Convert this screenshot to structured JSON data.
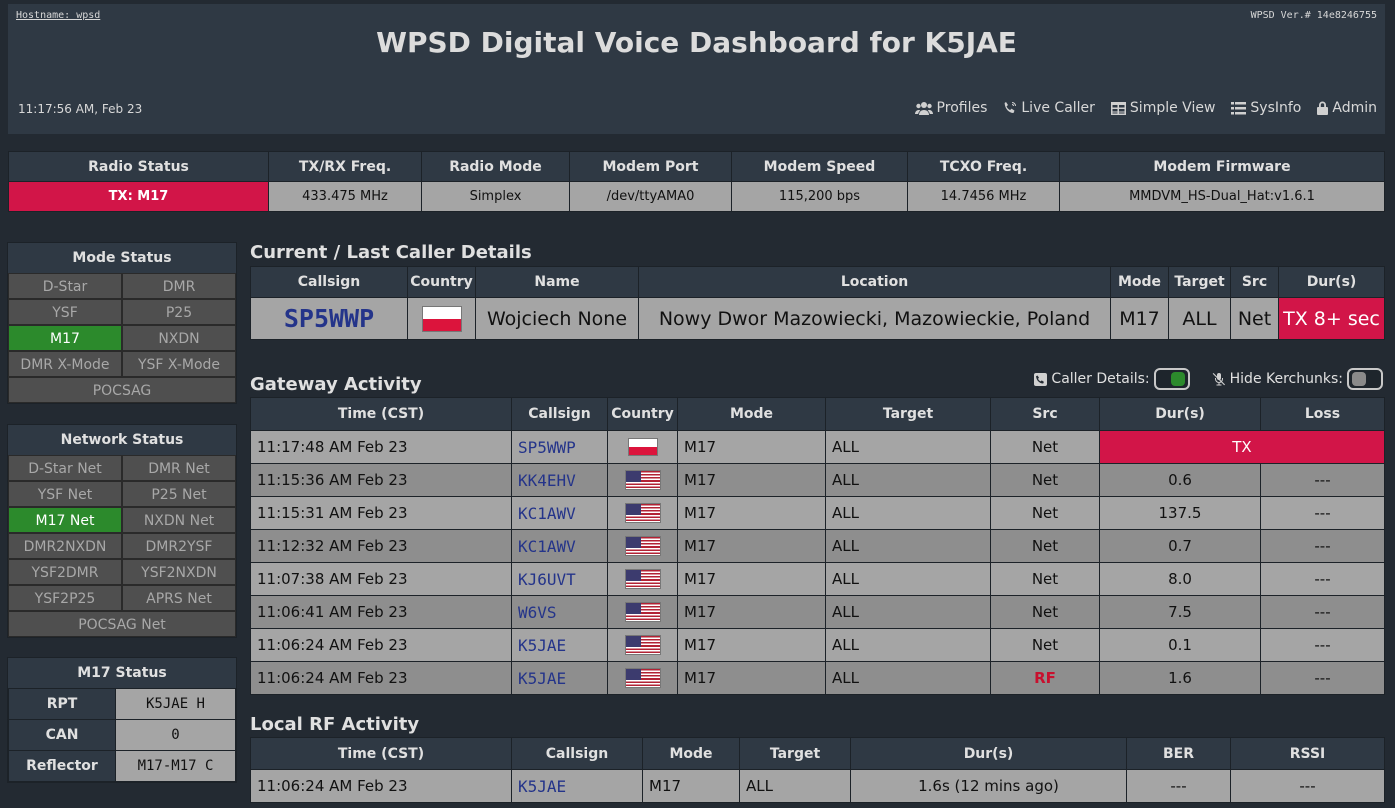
{
  "header": {
    "hostname": "Hostname: wpsd",
    "version": "WPSD Ver.# 14e8246755",
    "title": "WPSD Digital Voice Dashboard for K5JAE",
    "clock": "11:17:56 AM, Feb 23",
    "nav": [
      {
        "label": "Profiles",
        "icon": "users-icon"
      },
      {
        "label": "Live Caller",
        "icon": "phone-wave-icon"
      },
      {
        "label": "Simple View",
        "icon": "table-icon"
      },
      {
        "label": "SysInfo",
        "icon": "list-icon"
      },
      {
        "label": "Admin",
        "icon": "lock-icon"
      }
    ]
  },
  "radio": {
    "headers": [
      "Radio Status",
      "TX/RX Freq.",
      "Radio Mode",
      "Modem Port",
      "Modem Speed",
      "TCXO Freq.",
      "Modem Firmware"
    ],
    "values": [
      "TX: M17",
      "433.475 MHz",
      "Simplex",
      "/dev/ttyAMA0",
      "115,200 bps",
      "14.7456 MHz",
      "MMDVM_HS-Dual_Hat:v1.6.1"
    ]
  },
  "mode_status": {
    "title": "Mode Status",
    "items": [
      {
        "label": "D-Star",
        "active": false
      },
      {
        "label": "DMR",
        "active": false
      },
      {
        "label": "YSF",
        "active": false
      },
      {
        "label": "P25",
        "active": false
      },
      {
        "label": "M17",
        "active": true
      },
      {
        "label": "NXDN",
        "active": false
      },
      {
        "label": "DMR X-Mode",
        "active": false
      },
      {
        "label": "YSF X-Mode",
        "active": false
      },
      {
        "label": "POCSAG",
        "active": false
      }
    ]
  },
  "network_status": {
    "title": "Network Status",
    "items": [
      {
        "label": "D-Star Net",
        "active": false
      },
      {
        "label": "DMR Net",
        "active": false
      },
      {
        "label": "YSF Net",
        "active": false
      },
      {
        "label": "P25 Net",
        "active": false
      },
      {
        "label": "M17 Net",
        "active": true
      },
      {
        "label": "NXDN Net",
        "active": false
      },
      {
        "label": "DMR2NXDN",
        "active": false
      },
      {
        "label": "DMR2YSF",
        "active": false
      },
      {
        "label": "YSF2DMR",
        "active": false
      },
      {
        "label": "YSF2NXDN",
        "active": false
      },
      {
        "label": "YSF2P25",
        "active": false
      },
      {
        "label": "APRS Net",
        "active": false
      },
      {
        "label": "POCSAG Net",
        "active": false
      }
    ]
  },
  "m17_status": {
    "title": "M17 Status",
    "rows": [
      {
        "key": "RPT",
        "value": "K5JAE H"
      },
      {
        "key": "CAN",
        "value": "0"
      },
      {
        "key": "Reflector",
        "value": "M17-M17 C"
      }
    ]
  },
  "caller": {
    "title": "Current / Last Caller Details",
    "headers": [
      "Callsign",
      "Country",
      "Name",
      "Location",
      "Mode",
      "Target",
      "Src",
      "Dur(s)"
    ],
    "callsign": "SP5WWP",
    "country_flag": "poland-flag",
    "name": "Wojciech None",
    "location": "Nowy Dwor Mazowiecki, Mazowieckie, Poland",
    "mode": "M17",
    "target": "ALL",
    "src": "Net",
    "duration": "TX 8+ sec"
  },
  "gateway": {
    "title": "Gateway Activity",
    "caller_details_label": "Caller Details:",
    "caller_details_on": true,
    "hide_kerchunks_label": "Hide Kerchunks:",
    "hide_kerchunks_on": false,
    "headers": [
      "Time (CST)",
      "Callsign",
      "Country",
      "Mode",
      "Target",
      "Src",
      "Dur(s)",
      "Loss"
    ],
    "rows": [
      {
        "time": "11:17:48 AM Feb 23",
        "callsign": "SP5WWP",
        "flag": "pl",
        "mode": "M17",
        "target": "ALL",
        "src": "Net",
        "dur": "TX",
        "loss": ""
      },
      {
        "time": "11:15:36 AM Feb 23",
        "callsign": "KK4EHV",
        "flag": "us",
        "mode": "M17",
        "target": "ALL",
        "src": "Net",
        "dur": "0.6",
        "loss": "---"
      },
      {
        "time": "11:15:31 AM Feb 23",
        "callsign": "KC1AWV",
        "flag": "us",
        "mode": "M17",
        "target": "ALL",
        "src": "Net",
        "dur": "137.5",
        "loss": "---"
      },
      {
        "time": "11:12:32 AM Feb 23",
        "callsign": "KC1AWV",
        "flag": "us",
        "mode": "M17",
        "target": "ALL",
        "src": "Net",
        "dur": "0.7",
        "loss": "---"
      },
      {
        "time": "11:07:38 AM Feb 23",
        "callsign": "KJ6UVT",
        "flag": "us",
        "mode": "M17",
        "target": "ALL",
        "src": "Net",
        "dur": "8.0",
        "loss": "---"
      },
      {
        "time": "11:06:41 AM Feb 23",
        "callsign": "W6VS",
        "flag": "us",
        "mode": "M17",
        "target": "ALL",
        "src": "Net",
        "dur": "7.5",
        "loss": "---"
      },
      {
        "time": "11:06:24 AM Feb 23",
        "callsign": "K5JAE",
        "flag": "us",
        "mode": "M17",
        "target": "ALL",
        "src": "Net",
        "dur": "0.1",
        "loss": "---"
      },
      {
        "time": "11:06:24 AM Feb 23",
        "callsign": "K5JAE",
        "flag": "us",
        "mode": "M17",
        "target": "ALL",
        "src": "RF",
        "dur": "1.6",
        "loss": "---"
      }
    ]
  },
  "local_rf": {
    "title": "Local RF Activity",
    "headers": [
      "Time (CST)",
      "Callsign",
      "Mode",
      "Target",
      "Dur(s)",
      "BER",
      "RSSI"
    ],
    "rows": [
      {
        "time": "11:06:24 AM Feb 23",
        "callsign": "K5JAE",
        "mode": "M17",
        "target": "ALL",
        "dur": "1.6s (12 mins ago)",
        "ber": "---",
        "rssi": "---"
      }
    ]
  }
}
